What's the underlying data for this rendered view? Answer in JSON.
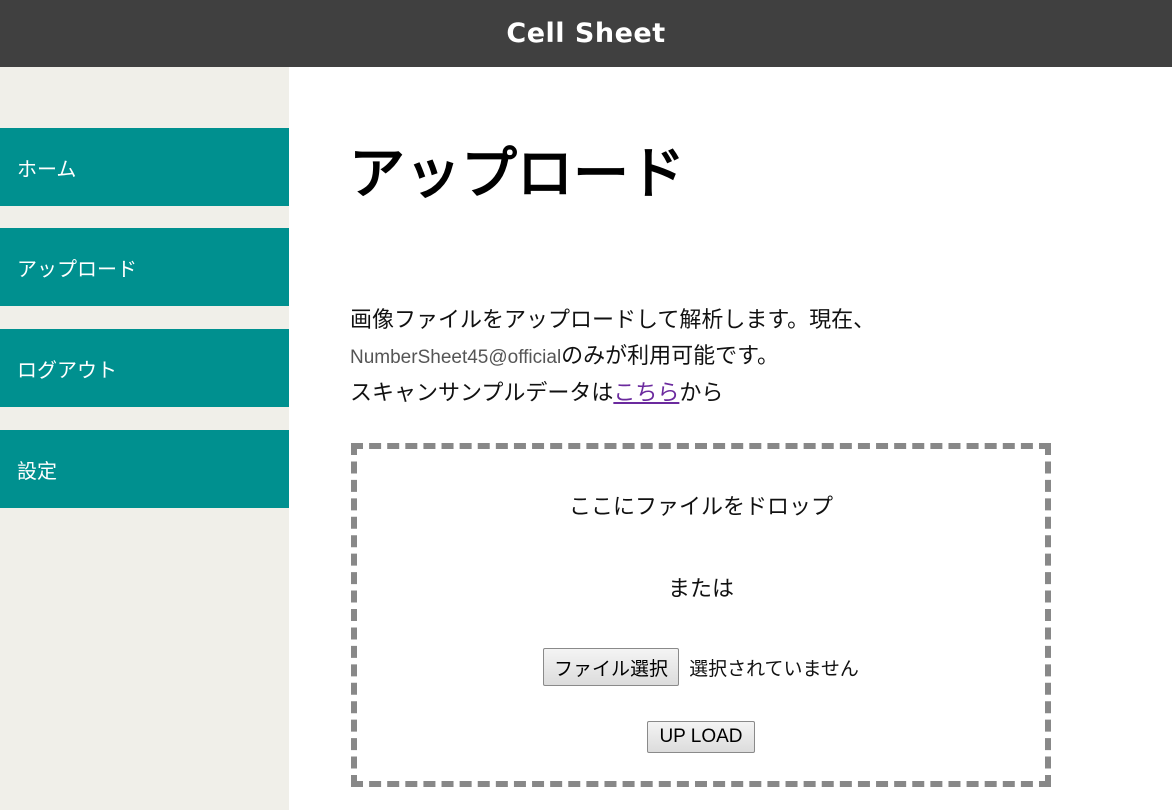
{
  "header": {
    "title": "Cell Sheet"
  },
  "sidebar": {
    "items": [
      {
        "label": "ホーム"
      },
      {
        "label": "アップロード"
      },
      {
        "label": "ログアウト"
      },
      {
        "label": "設定"
      }
    ]
  },
  "main": {
    "title": "アップロード",
    "description": {
      "line1": "画像ファイルをアップロードして解析します。現在、",
      "account": "NumberSheet45@official",
      "line2_suffix": "のみが利用可能です。",
      "line3_prefix": "スキャンサンプルデータは",
      "link": "こちら",
      "line3_suffix": "から"
    },
    "dropzone": {
      "drop_text": "ここにファイルをドロップ",
      "or_text": "または",
      "file_button": "ファイル選択",
      "file_status": "選択されていません",
      "upload_button": "UP LOAD"
    }
  },
  "colors": {
    "header_bg": "#404040",
    "sidebar_bg": "#f0efe9",
    "nav_item_bg": "#00908f",
    "link": "#6b2a9e"
  }
}
